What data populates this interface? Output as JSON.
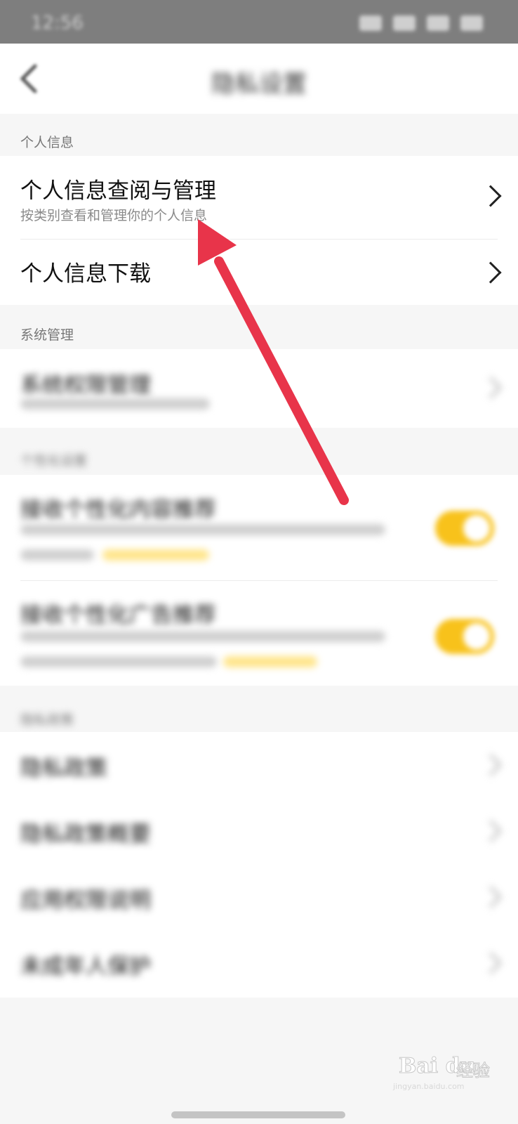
{
  "status_bar": {
    "time": "12:56"
  },
  "nav": {
    "title": "隐私设置"
  },
  "sections": {
    "personal": {
      "header": "个人信息",
      "items": [
        {
          "title": "个人信息查阅与管理",
          "subtitle": "按类别查看和管理你的个人信息"
        },
        {
          "title": "个人信息下载"
        }
      ]
    },
    "system": {
      "header": "系统管理",
      "items": [
        {
          "title": "系统权限管理"
        }
      ]
    },
    "personalization": {
      "header": "个性化设置",
      "items": [
        {
          "title": "接收个性化内容推荐",
          "toggle_on": true
        },
        {
          "title": "接收个性化广告推荐",
          "toggle_on": true
        }
      ]
    },
    "policies": {
      "header": "隐私政策",
      "items": [
        {
          "title": "隐私政策"
        },
        {
          "title": "隐私政策概要"
        },
        {
          "title": "应用权限说明"
        },
        {
          "title": "未成年人保护"
        }
      ]
    }
  },
  "watermark": {
    "brand": "Bai du",
    "cn": "经验",
    "url": "jingyan.baidu.com"
  },
  "colors": {
    "accent_arrow": "#e8344a",
    "toggle_on": "#f8c21b"
  }
}
